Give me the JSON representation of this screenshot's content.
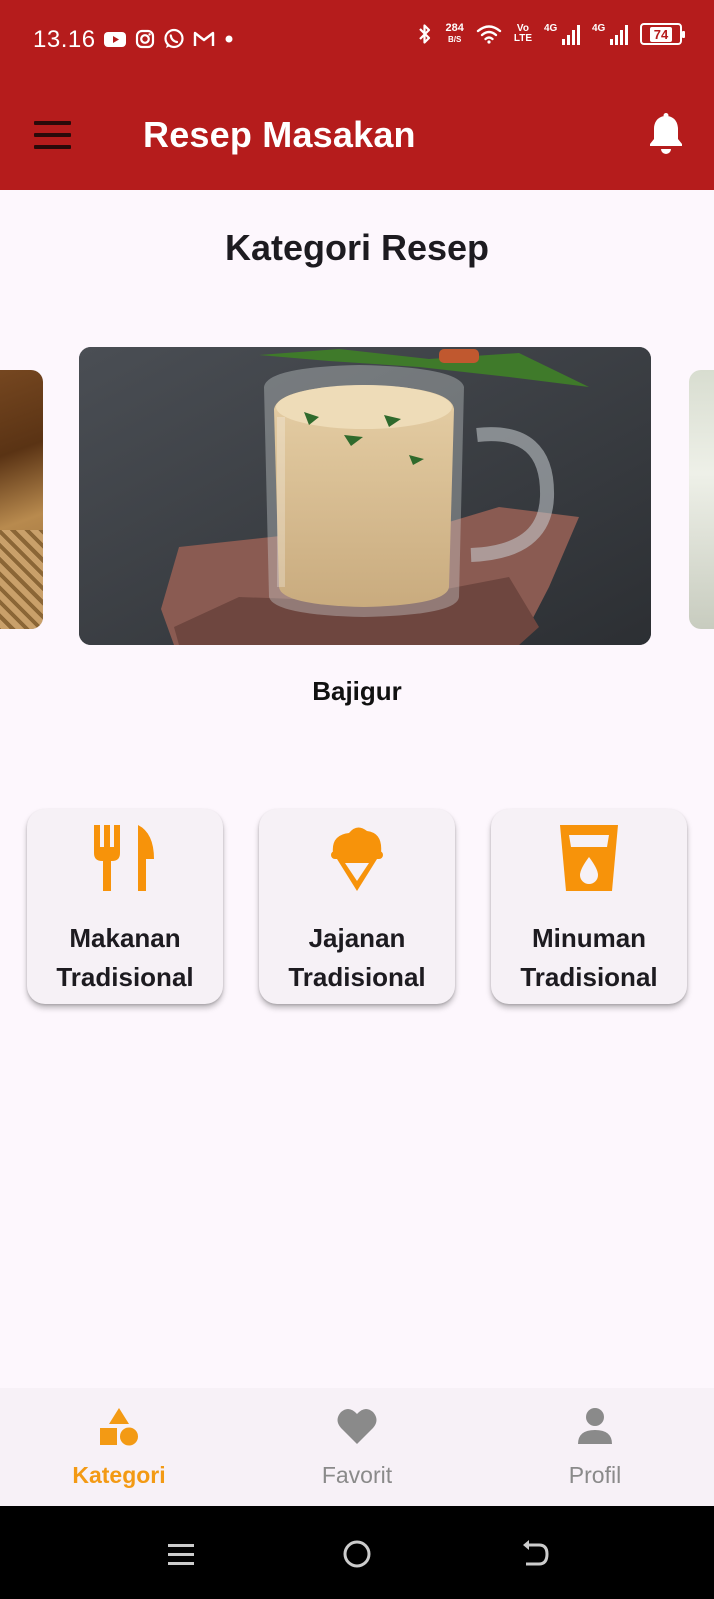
{
  "status_bar": {
    "time": "13.16",
    "left_icons": [
      "youtube-icon",
      "instagram-icon",
      "whatsapp-icon",
      "gmail-icon",
      "dot-icon"
    ],
    "net_speed_value": "284",
    "net_speed_unit": "B/S",
    "volte_top": "Vo",
    "volte_bottom": "LTE",
    "signal_1_label": "4G",
    "signal_2_label": "4G",
    "battery": "74"
  },
  "app_bar": {
    "title": "Resep Masakan",
    "menu_icon": "hamburger-menu-icon",
    "notification_icon": "bell-icon"
  },
  "page": {
    "title": "Kategori Resep"
  },
  "carousel": {
    "current_caption": "Bajigur"
  },
  "categories": [
    {
      "line1": "Makanan",
      "line2": "Tradisional",
      "icon": "fork-knife-icon"
    },
    {
      "line1": "Jajanan",
      "line2": "Tradisional",
      "icon": "ice-cream-icon"
    },
    {
      "line1": "Minuman",
      "line2": "Tradisional",
      "icon": "drink-glass-icon"
    }
  ],
  "bottom_nav": {
    "items": [
      {
        "label": "Kategori",
        "icon": "category-icon",
        "active": true
      },
      {
        "label": "Favorit",
        "icon": "heart-icon",
        "active": false
      },
      {
        "label": "Profil",
        "icon": "person-icon",
        "active": false
      }
    ]
  },
  "colors": {
    "primary": "#b51c1c",
    "accent": "#f39a14",
    "background": "#fdf7fd",
    "inactive": "#8a8a8a"
  }
}
